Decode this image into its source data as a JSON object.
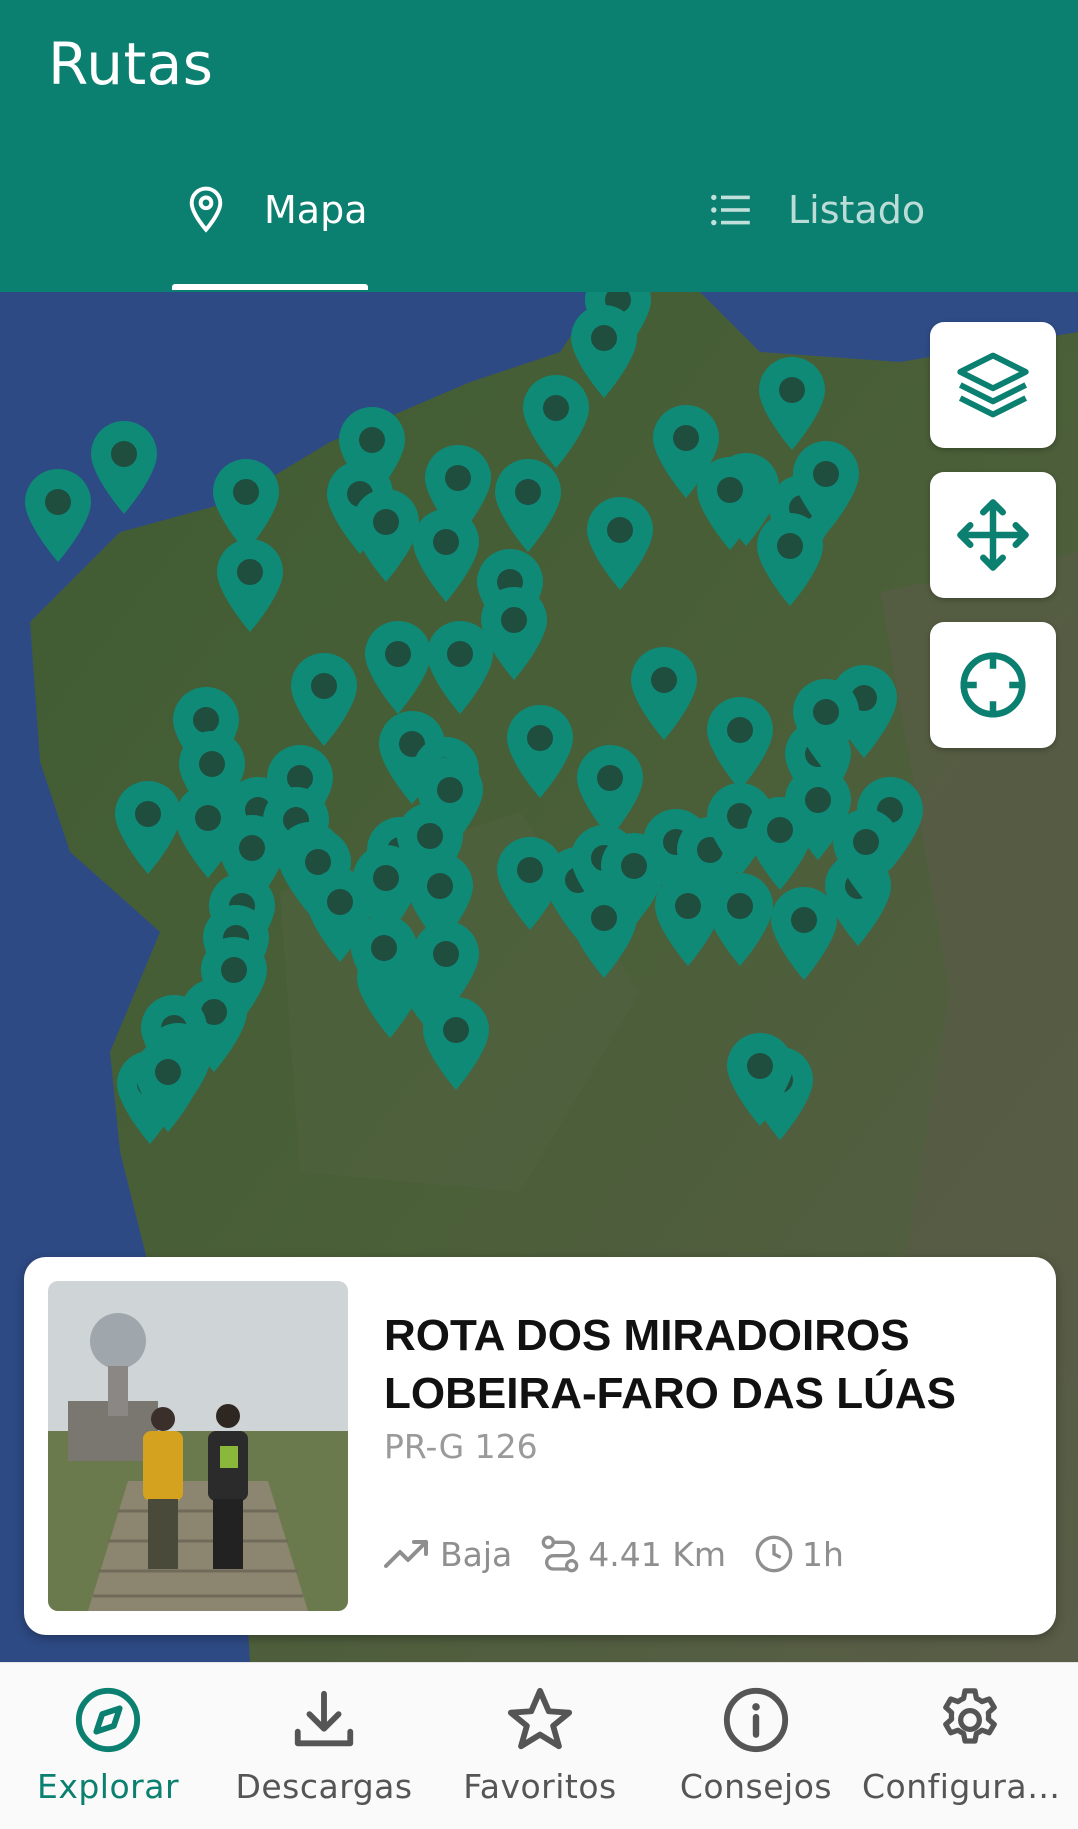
{
  "colors": {
    "primary": "#0b8070",
    "pin": "#0f8a77",
    "pin_dot": "#1f4e3f",
    "sea": "#33508a",
    "land": "#3e5a32"
  },
  "app_bar": {
    "title": "Rutas"
  },
  "tabs": [
    {
      "label": "Mapa",
      "icon": "map-pin-icon",
      "selected": true
    },
    {
      "label": "Listado",
      "icon": "list-icon",
      "selected": false
    }
  ],
  "map_controls": [
    {
      "name": "layers-button",
      "icon": "layers-icon"
    },
    {
      "name": "pan-button",
      "icon": "move-icon"
    },
    {
      "name": "locate-button",
      "icon": "crosshair-icon"
    }
  ],
  "route_card": {
    "title": "ROTA DOS MIRADOIROS LOBEIRA-FARO DAS LÚAS",
    "code": "PR-G 126",
    "difficulty": "Baja",
    "distance": "4.41 Km",
    "duration": "1h"
  },
  "bottom_nav": [
    {
      "label": "Explorar",
      "icon": "compass-icon",
      "active": true
    },
    {
      "label": "Descargas",
      "icon": "download-icon",
      "active": false
    },
    {
      "label": "Favoritos",
      "icon": "star-icon",
      "active": false
    },
    {
      "label": "Consejos",
      "icon": "info-icon",
      "active": false
    },
    {
      "label": "Configurac…",
      "icon": "gear-icon",
      "active": false
    }
  ]
}
